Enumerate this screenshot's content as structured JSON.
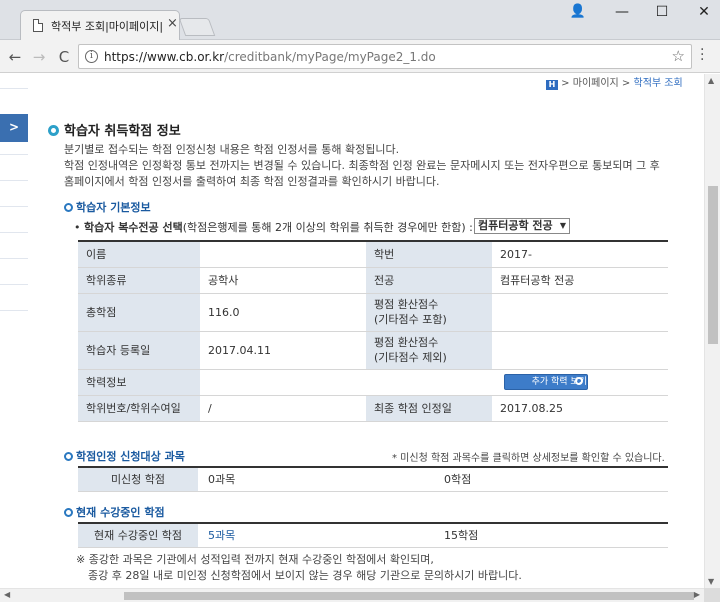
{
  "browser": {
    "tab_title": "학적부 조회|마이페이지|",
    "tab_close": "×",
    "url_host": "https://www.cb.or.kr",
    "url_path": "/creditbank/myPage/myPage2_1.do",
    "info_glyph": "i",
    "star_glyph": "☆",
    "user_glyph": "👤",
    "min_glyph": "—",
    "max_glyph": "☐",
    "close_glyph": "✕",
    "back_glyph": "←",
    "forward_glyph": "→",
    "reload_glyph": "C"
  },
  "breadcrumb": {
    "home": "H",
    "sep1": " > ",
    "level1": "마이페이지",
    "sep2": " > ",
    "current": "학적부 조회"
  },
  "side_toggle": ">",
  "section": {
    "title": "학습자 취득학점 정보",
    "intro_lines": [
      "분기별로 접수되는 학점 인정신청 내용은 학점 인정서를 통해 확정됩니다.",
      "학점 인정내역은 인정확정 통보 전까지는 변경될 수 있습니다. 최종학점 인정 완료는 문자메시지 또는 전자우편으로 통보되며 그 후",
      "홈페이지에서 학점 인정서를 출력하여 최종 학점 인정결과를 확인하시기 바랍니다."
    ]
  },
  "basic_info": {
    "title": "학습자 기본정보",
    "select_bullet": "•",
    "select_label": "학습자 복수전공 선택",
    "select_note": "(학점은행제를 통해 2개 이상의 학위를 취득한 경우에만 한함) :",
    "select_value": "컴퓨터공학 전공",
    "select_arrow": "▼",
    "labels": {
      "name": "이름",
      "student_no": "학번",
      "degree_type": "학위종류",
      "major": "전공",
      "total_credits": "총학점",
      "gpa_incl_line1": "평점 환산점수",
      "gpa_incl_line2": "(기타점수 포함)",
      "reg_date": "학습자 등록일",
      "gpa_excl_line1": "평점 환산점수",
      "gpa_excl_line2": "(기타점수 제외)",
      "academic_history": "학력정보",
      "degree_no": "학위번호/학위수여일",
      "final_date": "최종 학점 인정일"
    },
    "values": {
      "name": "",
      "student_no": "2017-",
      "degree_type": "공학사",
      "major": "컴퓨터공학 전공",
      "total_credits": "116.0",
      "gpa_incl": "",
      "reg_date": "2017.04.11",
      "gpa_excl": "",
      "degree_no": "/",
      "final_date": "2017.08.25"
    },
    "history_button": "추가 학력 보기"
  },
  "pending": {
    "title": "학점인정 신청대상 과목",
    "note": "* 미신청 학점 과목수를 클릭하면 상세정보를 확인할 수 있습니다.",
    "row_label": "미신청 학점",
    "courses": "0과목",
    "credits": "0학점"
  },
  "current": {
    "title": "현재 수강중인 학점",
    "row_label": "현재 수강중인 학점",
    "courses": "5과목",
    "credits": "15학점"
  },
  "footnote": [
    "※ 종강한 과목은 기관에서 성적입력 전까지 현재 수강중인 학점에서 확인되며,",
    "종강 후 28일 내로 미인정 신청학점에서 보이지 않는 경우 해당 기관으로 문의하시기 바랍니다."
  ],
  "scroll": {
    "up": "▲",
    "down": "▼",
    "left": "◀",
    "right": "▶"
  }
}
